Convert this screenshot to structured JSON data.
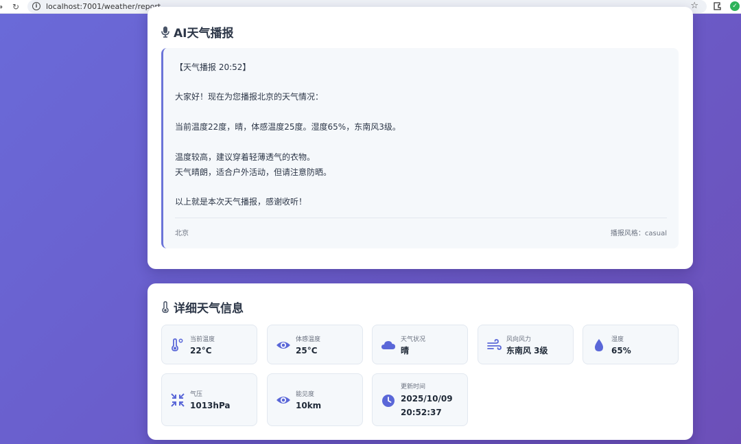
{
  "browser": {
    "url": "localhost:7001/weather/report",
    "info_icon_glyph": "i",
    "star_glyph": "☆",
    "back_glyph": "→",
    "reload_glyph": "↻",
    "ext_glyph": "✓"
  },
  "broadcast": {
    "title": "AI天气播报",
    "lines": [
      "【天气播报 20:52】",
      "大家好！现在为您播报北京的天气情况：",
      "当前温度22度，晴，体感温度25度。湿度65%，东南风3级。",
      "温度较高，建议穿着轻薄透气的衣物。",
      "天气晴朗，适合户外活动，但请注意防晒。",
      "以上就是本次天气播报，感谢收听！"
    ],
    "city": "北京",
    "style_label": "播报风格：casual"
  },
  "details": {
    "title": "详细天气信息",
    "items": [
      {
        "icon": "thermometer-icon",
        "label": "当前温度",
        "value": "22°C"
      },
      {
        "icon": "eye-icon",
        "label": "体感温度",
        "value": "25°C"
      },
      {
        "icon": "cloud-icon",
        "label": "天气状况",
        "value": "晴"
      },
      {
        "icon": "wind-icon",
        "label": "风向风力",
        "value": "东南风 3级"
      },
      {
        "icon": "droplet-icon",
        "label": "湿度",
        "value": "65%"
      },
      {
        "icon": "compress-icon",
        "label": "气压",
        "value": "1013hPa"
      },
      {
        "icon": "eye-icon",
        "label": "能见度",
        "value": "10km"
      },
      {
        "icon": "clock-icon",
        "label": "更新时间",
        "value": "2025/10/09",
        "value2": "20:52:37"
      }
    ]
  },
  "colors": {
    "accent": "#6b74d8",
    "icon": "#5a67d8",
    "background_start": "#6a6ad8",
    "background_end": "#6c4fb8"
  }
}
